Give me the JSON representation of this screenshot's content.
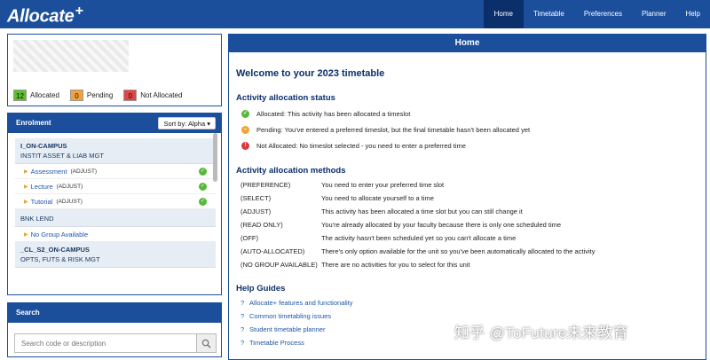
{
  "app": {
    "logo": "Allocate",
    "logo_plus": "+"
  },
  "nav": {
    "items": [
      {
        "label": "Home",
        "active": true
      },
      {
        "label": "Timetable"
      },
      {
        "label": "Preferences"
      },
      {
        "label": "Planner"
      },
      {
        "label": "Help"
      }
    ]
  },
  "counts": {
    "allocated_num": "12",
    "allocated_label": "Allocated",
    "pending_num": "0",
    "pending_label": "Pending",
    "not_allocated_num": "0",
    "not_allocated_label": "Not Allocated"
  },
  "enrolment": {
    "title": "Enrolment",
    "sort_label": "Sort by: Alpha",
    "units": [
      {
        "code": "I_ON-CAMPUS",
        "name": "INSTIT ASSET & LIAB MGT",
        "activities": [
          {
            "name": "Assessment",
            "adjust": "(ADJUST)"
          },
          {
            "name": "Lecture",
            "adjust": "(ADJUST)"
          },
          {
            "name": "Tutorial",
            "adjust": "(ADJUST)"
          }
        ]
      },
      {
        "code": "",
        "name": "BNK LEND",
        "activities": [
          {
            "name": "No Group Available",
            "adjust": ""
          }
        ]
      },
      {
        "code": "_CL_S2_ON-CAMPUS",
        "name": "OPTS, FUTS & RISK MGT",
        "activities": []
      }
    ]
  },
  "search": {
    "title": "Search",
    "placeholder": "Search code or description"
  },
  "home": {
    "title": "Home",
    "welcome": "Welcome to your 2023 timetable",
    "status_title": "Activity allocation status",
    "statuses": [
      {
        "text": "Allocated: This activity has been allocated a timeslot",
        "color": "#58b83a"
      },
      {
        "text": "Pending: You've entered a preferred timeslot, but the final timetable hasn't been allocated yet",
        "color": "#f3a23b"
      },
      {
        "text": "Not Allocated: No timeslot selected - you need to enter a preferred time",
        "color": "#d93a3a"
      }
    ],
    "methods_title": "Activity allocation methods",
    "methods": [
      {
        "key": "(PREFERENCE)",
        "desc": "You need to enter your preferred time slot"
      },
      {
        "key": "(SELECT)",
        "desc": "You need to allocate yourself to a time"
      },
      {
        "key": "(ADJUST)",
        "desc": "This activity has been allocated a time slot but you can still change it"
      },
      {
        "key": "(READ ONLY)",
        "desc": "You're already allocated by your faculty because there is only one scheduled time"
      },
      {
        "key": "(OFF)",
        "desc": "The activity hasn't been scheduled yet so you can't allocate a time"
      },
      {
        "key": "(AUTO-ALLOCATED)",
        "desc": "There's only option available for the unit so you've been automatically allocated to the activity"
      },
      {
        "key": "(NO GROUP AVAILABLE)",
        "desc": "There are no activities for you to select for this unit"
      }
    ],
    "guides_title": "Help Guides",
    "guides": [
      {
        "q": "?",
        "label": "Allocate+ features and functionality"
      },
      {
        "q": "?",
        "label": "Common timetabling issues"
      },
      {
        "q": "?",
        "label": "Student timetable planner"
      },
      {
        "q": "?",
        "label": "Timetable Process"
      }
    ]
  },
  "watermark": "知乎 @ToFuture未来教育",
  "colors": {
    "brand": "#1b4f9c",
    "brand_dark": "#0b2f6b",
    "allocated": "#5cc02d",
    "pending": "#f3a23b",
    "not_allocated": "#e04545"
  }
}
